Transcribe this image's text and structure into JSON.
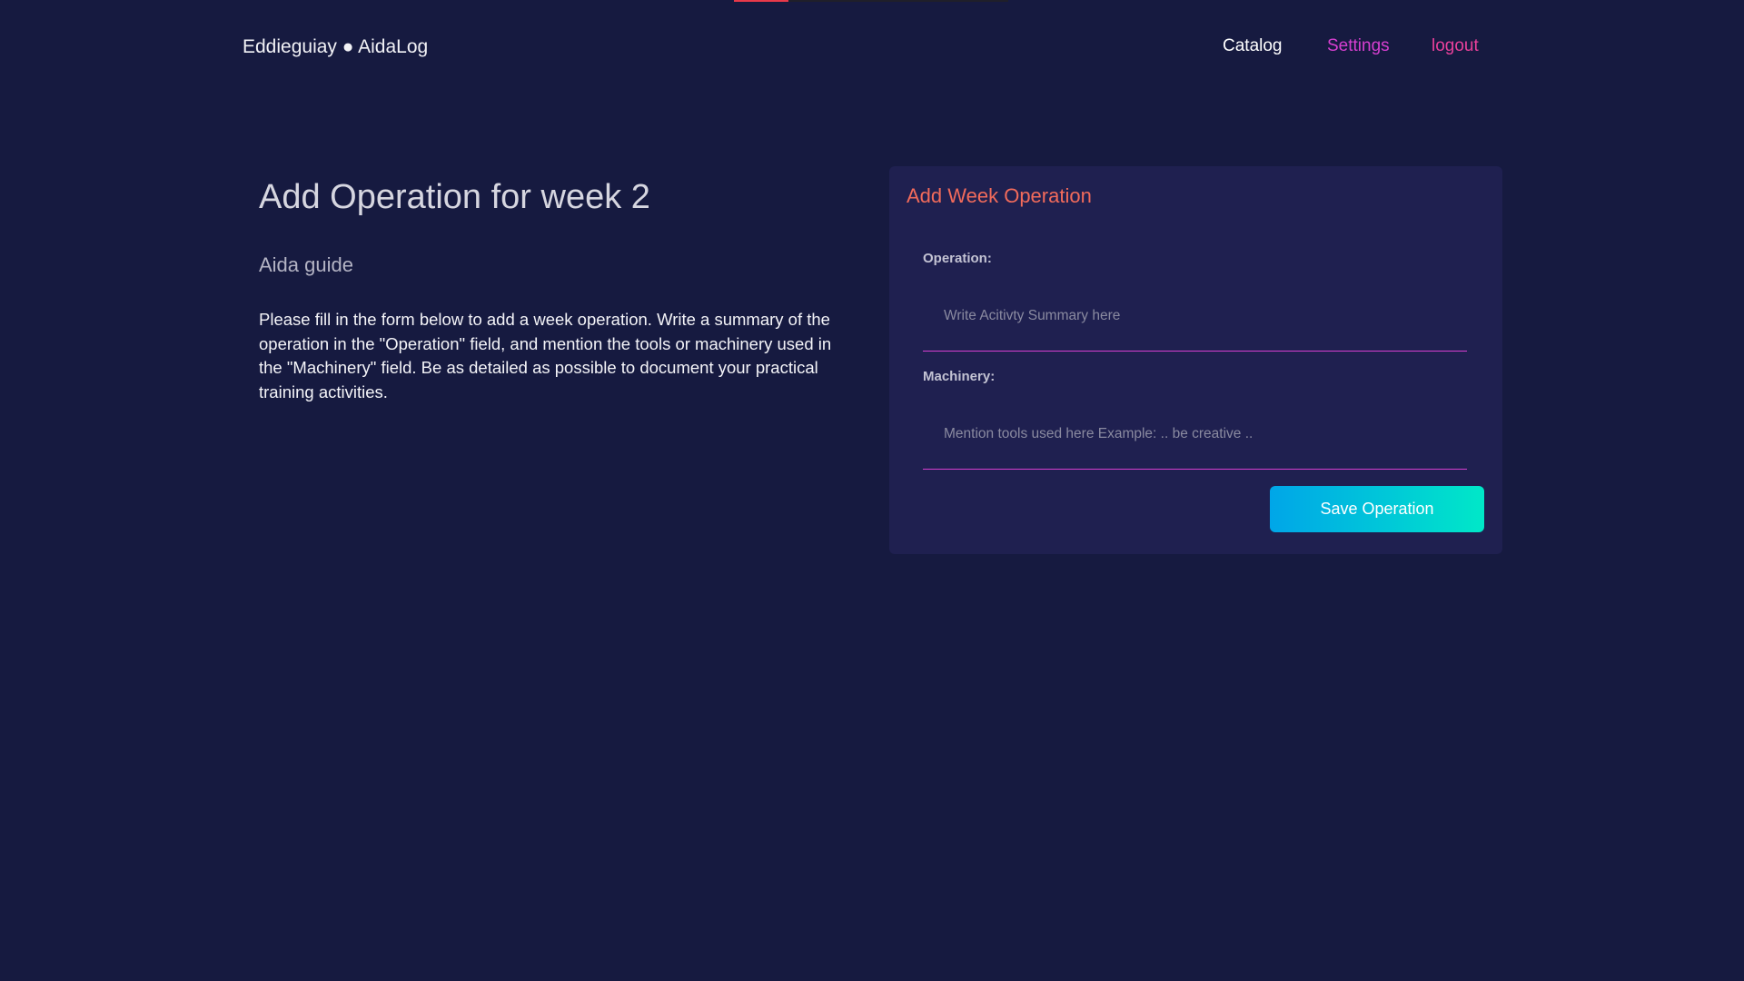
{
  "loading_bar": {
    "progress_percent": 20,
    "color": "#e8394a"
  },
  "header": {
    "brand": "Eddieguiay ● AidaLog",
    "nav": [
      {
        "label": "Catalog",
        "color": "#ffffff"
      },
      {
        "label": "Settings",
        "color": "#d63fd0"
      },
      {
        "label": "logout",
        "color": "#e8409a"
      }
    ]
  },
  "main": {
    "title": "Add Operation for week 2",
    "subtitle": "Aida guide",
    "description": "Please fill in the form below to add a week operation. Write a summary of the operation in the \"Operation\" field, and mention the tools or machinery used in the \"Machinery\" field. Be as detailed as possible to document your practical training activities."
  },
  "form": {
    "title": "Add Week Operation",
    "operation_label": "Operation:",
    "operation_value": "",
    "operation_placeholder": "Write Acitivty Summary here",
    "machinery_label": "Machinery:",
    "machinery_value": "",
    "machinery_placeholder": "Mention tools used here Example: .. be creative ..",
    "save_label": "Save Operation"
  },
  "colors": {
    "background": "#161a40",
    "card": "#1f2050",
    "accent": "#d63fd0",
    "card_title": "#f26b5b"
  }
}
